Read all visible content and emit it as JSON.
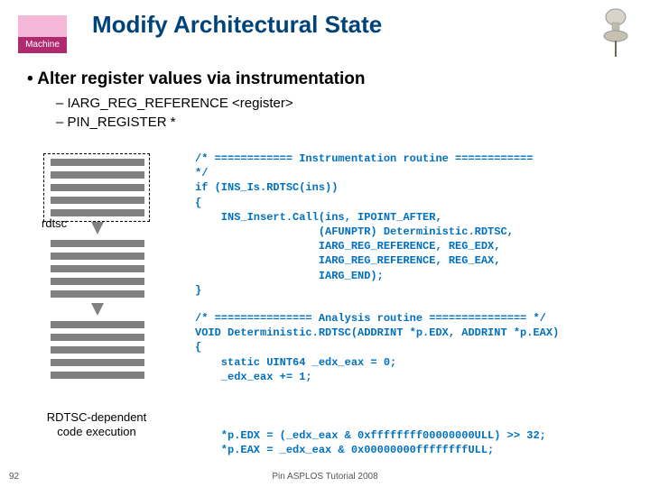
{
  "logo_label": "Machine",
  "title": "Modify Architectural State",
  "bullet_main": "• Alter register values via instrumentation",
  "sub1": "–  IARG_REG_REFERENCE <register>",
  "sub2": "–  PIN_REGISTER *",
  "rdtsc": "rdtsc",
  "caption": "RDTSC-dependent\ncode execution",
  "code1": "/* ============ Instrumentation routine ============\n*/\nif (INS_Is.RDTSC(ins))\n{\n    INS_Insert.Call(ins, IPOINT_AFTER,\n                   (AFUNPTR) Deterministic.RDTSC,\n                   IARG_REG_REFERENCE, REG_EDX,\n                   IARG_REG_REFERENCE, REG_EAX,\n                   IARG_END);\n}",
  "code2": "/* =============== Analysis routine =============== */\nVOID Deterministic.RDTSC(ADDRINT *p.EDX, ADDRINT *p.EAX)\n{\n    static UINT64 _edx_eax = 0;\n    _edx_eax += 1;",
  "code3": "    *p.EDX = (_edx_eax & 0xffffffff00000000ULL) >> 32;\n    *p.EAX = _edx_eax & 0x00000000ffffffffULL;",
  "slide_num": "92",
  "footer": "Pin ASPLOS Tutorial 2008"
}
